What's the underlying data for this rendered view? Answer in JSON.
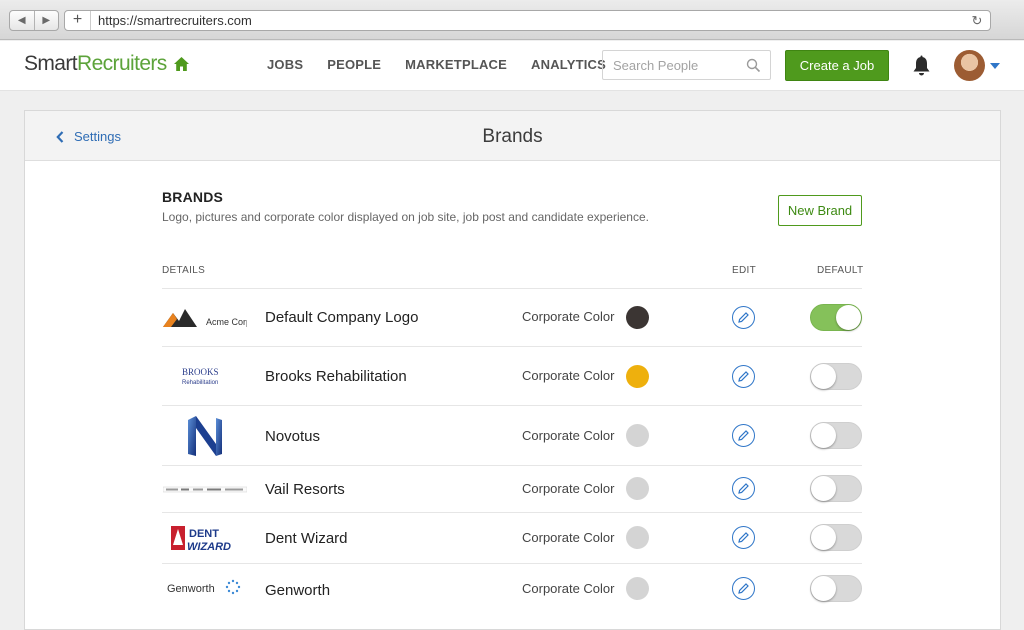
{
  "browser": {
    "back_glyph": "◀",
    "forward_glyph": "▶",
    "new_tab_glyph": "+",
    "url": "https://smartrecruiters.com",
    "reload_glyph": "↻"
  },
  "header": {
    "logo_part1": "Smart",
    "logo_part2": "Recruiters",
    "nav": [
      "JOBS",
      "PEOPLE",
      "MARKETPLACE",
      "ANALYTICS"
    ],
    "search_placeholder": "Search People",
    "create_job_label": "Create a Job"
  },
  "page": {
    "back_label": "Settings",
    "title": "Brands"
  },
  "brands_section": {
    "heading": "BRANDS",
    "description": "Logo, pictures and corporate color displayed on job site, job post and candidate experience.",
    "new_brand_label": "New Brand",
    "columns": {
      "details": "DETAILS",
      "edit": "EDIT",
      "default": "DEFAULT"
    }
  },
  "brands": [
    {
      "name": "Default Company Logo",
      "color_label": "Corporate Color",
      "color": "#3b3533",
      "default": true,
      "logo_text": "Acme Corp"
    },
    {
      "name": "Brooks Rehabilitation",
      "color_label": "Corporate Color",
      "color": "#eeb00d",
      "default": false,
      "logo_text": "BROOKS",
      "logo_sub": "Rehabilitation"
    },
    {
      "name": "Novotus",
      "color_label": "Corporate Color",
      "color": "#d4d4d4",
      "default": false,
      "logo_text": "N"
    },
    {
      "name": "Vail Resorts",
      "color_label": "Corporate Color",
      "color": "#d4d4d4",
      "default": false,
      "logo_text": ""
    },
    {
      "name": "Dent Wizard",
      "color_label": "Corporate Color",
      "color": "#d4d4d4",
      "default": false,
      "logo_text": "DENT",
      "logo_sub": "WIZARD"
    },
    {
      "name": "Genworth",
      "color_label": "Corporate Color",
      "color": "#d4d4d4",
      "default": false,
      "logo_text": "Genworth"
    }
  ],
  "colors": {
    "brand_green": "#4f9a1d",
    "link_blue": "#2f6db5",
    "toggle_on": "#85c15a"
  }
}
